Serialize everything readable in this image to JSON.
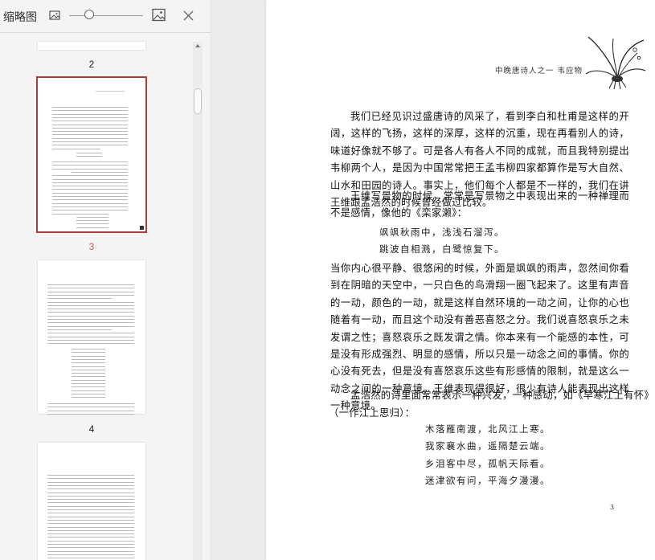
{
  "thumbnail_panel": {
    "title": "缩略图",
    "icons": {
      "small_image": "image-small-icon",
      "large_image": "image-large-icon",
      "close": "close-icon"
    },
    "zoom_level": 0.35,
    "page_numbers": [
      "2",
      "3",
      "4"
    ],
    "selected_page": "3"
  },
  "document": {
    "running_header": "中晚唐诗人之一   韦应物",
    "paragraphs": [
      "我们已经见识过盛唐诗的风采了，看到李白和杜甫是这样的开阔，这样的飞扬，这样的深厚，这样的沉重，现在再看别人的诗，味道好像就不够了。可是各人有各人不同的成就，而且我特别提出韦柳两个人，是因为中国常常把王孟韦柳四家都算作是写大自然、山水和田园的诗人。事实上，他们每个人都是不一样的，我们在讲王维跟孟浩然的时候曾经做过比较。",
      "王维写景物的时候，常常是写景物之中表现出来的一种禅理而不是感情，像他的《栾家濑》：",
      "当你内心很平静、很悠闲的时候，外面是飒飒的雨声，忽然间你看到在阴暗的天空中，一只白色的鸟滑翔一圈飞起来了。这里有声音的一动，颜色的一动，就是这样自然环境的一动之间，让你的心也随着有一动，而且这个动没有善恶喜怒之分。我们说喜怒哀乐之未发谓之性；喜怒哀乐之既发谓之情。你本来有一个能感的本性，可是没有形成强烈、明显的感情，所以只是一动念之间的事情。你的心没有死去，但是没有喜怒哀乐这些有形感情的限制，就是这么一动念之间的一种意境。王维表现得很好，很少有诗人能表现出这样一种意境。",
      "孟浩然的诗里面常常表示一种兴发，一种感动，如《早寒江上有怀》",
      "（一作江上思归）："
    ],
    "poem1": [
      "飒飒秋雨中，浅浅石溜泻。",
      "跳波自相溅，白鹭惊复下。"
    ],
    "poem2": [
      "木落雁南渡，北风江上寒。",
      "我家襄水曲，遥隔楚云端。",
      "乡泪客中尽，孤帆天际看。",
      "迷津欲有问，平海夕漫漫。"
    ],
    "page_number": "3"
  }
}
